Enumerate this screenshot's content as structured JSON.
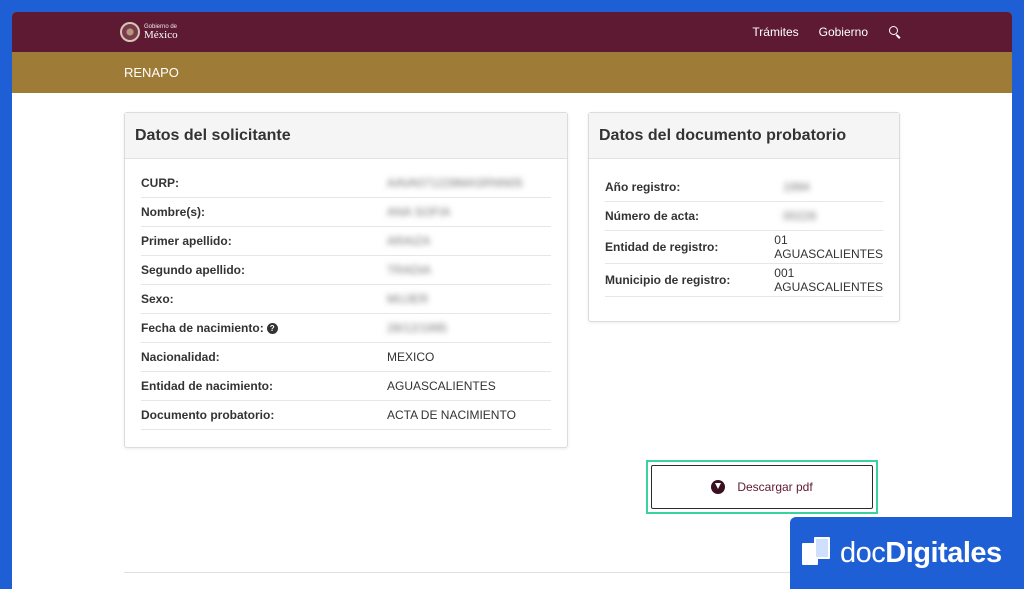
{
  "header": {
    "logo_small": "Gobierno de",
    "logo_big": "México",
    "nav": [
      "Trámites",
      "Gobierno"
    ],
    "search_icon": "search-icon"
  },
  "subheader": {
    "title": "RENAPO"
  },
  "solicitante": {
    "title": "Datos del solicitante",
    "rows": [
      {
        "label": "CURP:",
        "value": "AAVA071228MASRNN05"
      },
      {
        "label": "Nombre(s):",
        "value": "ANA SOFIA"
      },
      {
        "label": "Primer apellido:",
        "value": "ARAIZA"
      },
      {
        "label": "Segundo apellido:",
        "value": "TRADIA"
      },
      {
        "label": "Sexo:",
        "value": "MUJER"
      },
      {
        "label": "Fecha de nacimiento:",
        "value": "28/12/1995"
      },
      {
        "label": "Nacionalidad:",
        "value": "MEXICO"
      },
      {
        "label": "Entidad de nacimiento:",
        "value": "AGUASCALIENTES"
      },
      {
        "label": "Documento probatorio:",
        "value": "ACTA DE NACIMIENTO"
      }
    ]
  },
  "documento": {
    "title": "Datos del documento probatorio",
    "rows": [
      {
        "label": "Año registro:",
        "value": "1994"
      },
      {
        "label": "Número de acta:",
        "value": "00226"
      },
      {
        "label": "Entidad de registro:",
        "value": "01",
        "value2": "AGUASCALIENTES"
      },
      {
        "label": "Municipio de registro:",
        "value": "001",
        "value2": "AGUASCALIENTES"
      }
    ]
  },
  "download": {
    "label": "Descargar pdf"
  },
  "brand": {
    "prefix": "doc",
    "name": "Digitales"
  }
}
